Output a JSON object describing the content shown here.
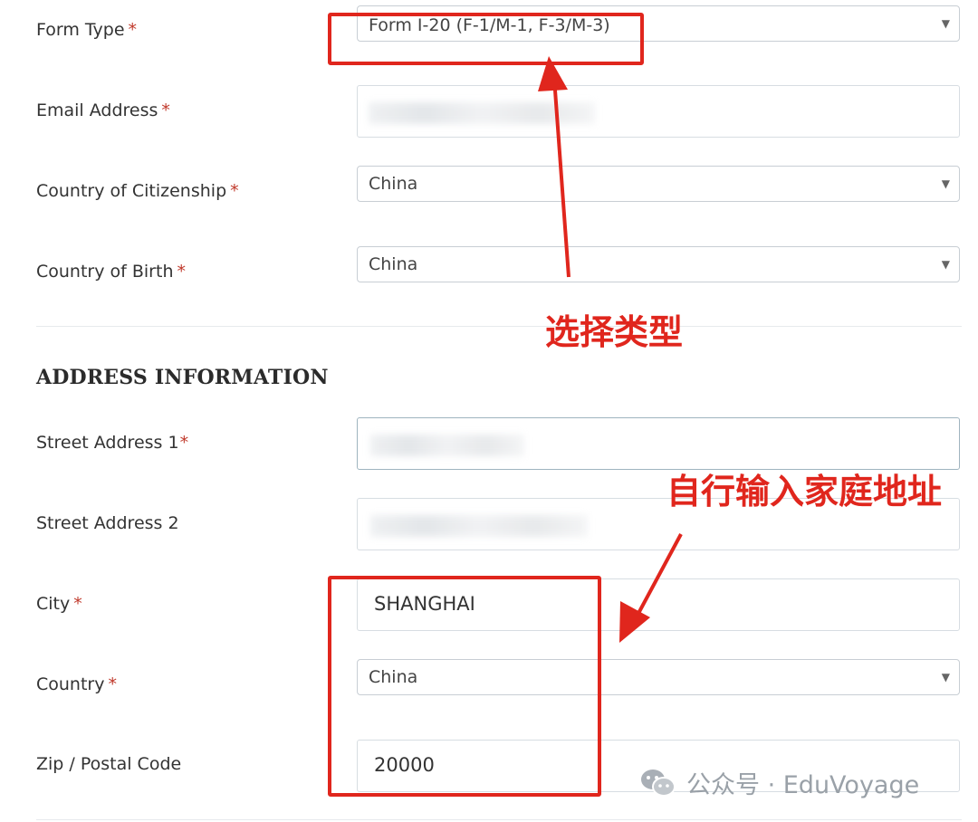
{
  "form": {
    "required_mark": "*",
    "rows": {
      "form_type": {
        "label": "Form Type",
        "value": "Form I-20 (F-1/M-1, F-3/M-3)"
      },
      "email": {
        "label": "Email Address"
      },
      "citizenship": {
        "label": "Country of Citizenship",
        "value": "China"
      },
      "birth": {
        "label": "Country of Birth",
        "value": "China"
      }
    },
    "address": {
      "title": "ADDRESS INFORMATION",
      "street1": {
        "label": "Street Address 1"
      },
      "street2": {
        "label": "Street Address 2"
      },
      "city": {
        "label": "City",
        "value": "SHANGHAI"
      },
      "country": {
        "label": "Country",
        "value": "China"
      },
      "zip": {
        "label": "Zip / Postal Code",
        "value": "20000"
      }
    }
  },
  "annotations": {
    "select_type": "选择类型",
    "enter_address": "自行输入家庭地址",
    "color": "#e0261d"
  },
  "watermark": {
    "text": "公众号 · EduVoyage",
    "icon": "wechat-icon"
  }
}
